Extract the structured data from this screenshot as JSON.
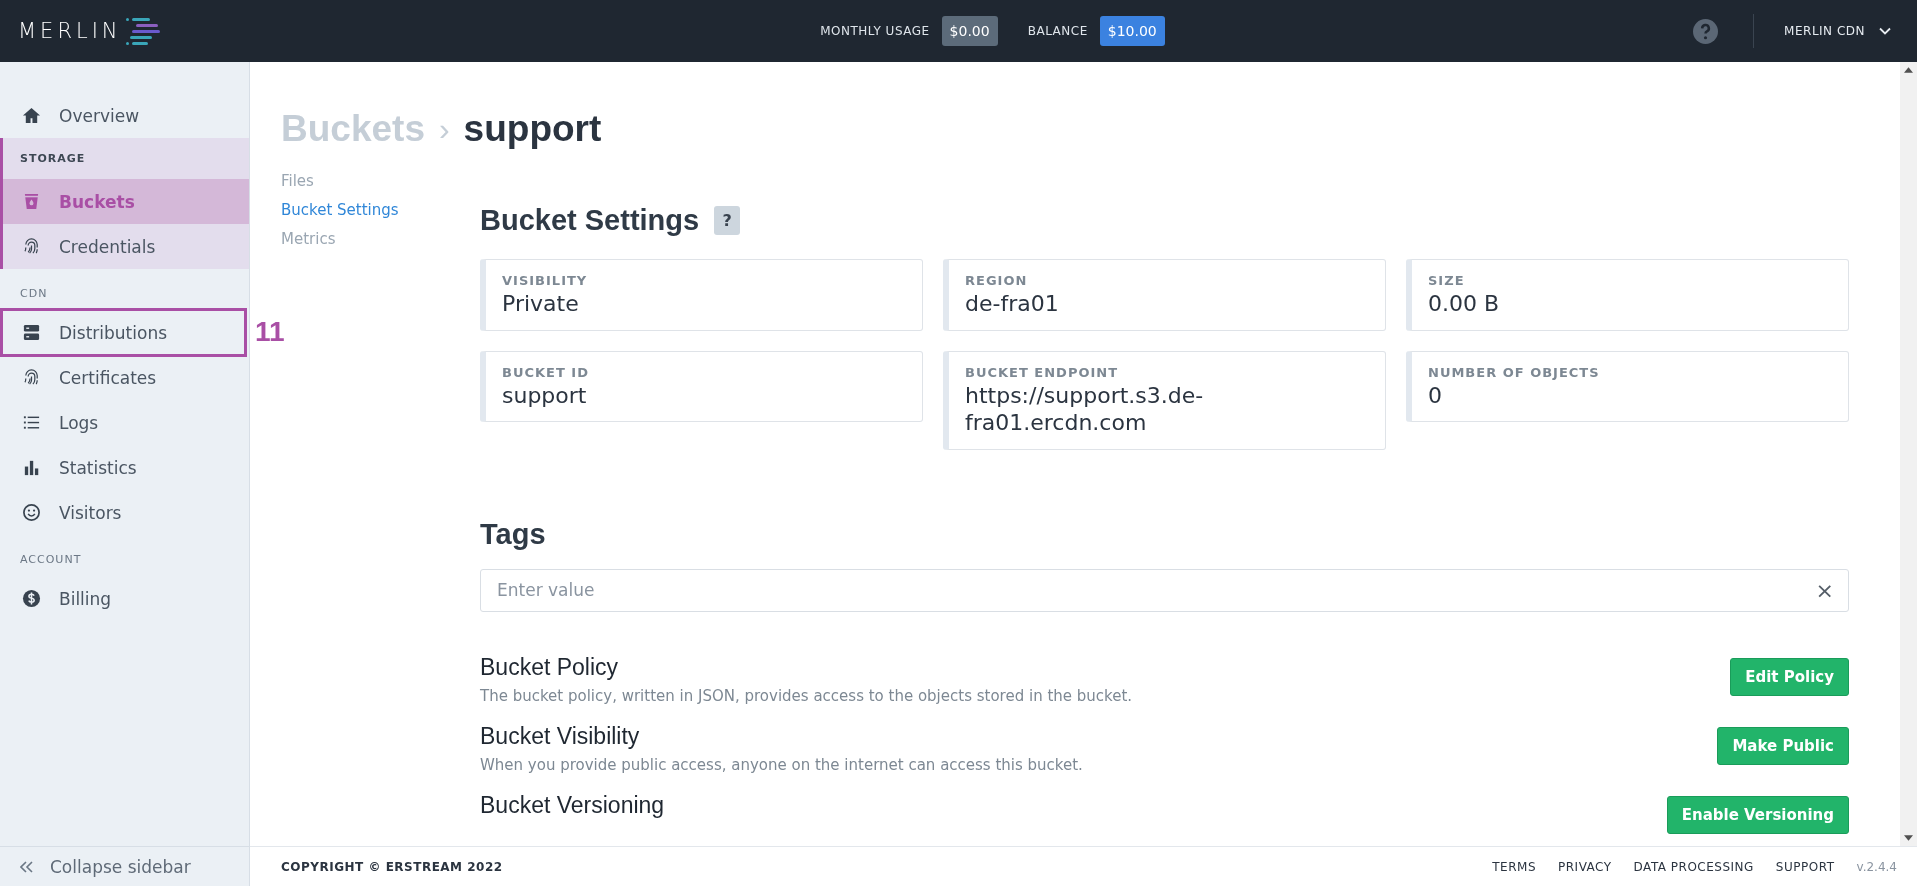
{
  "topbar": {
    "logo": "MERLIN",
    "meters": [
      {
        "label": "MONTHLY USAGE",
        "value": "$0.00",
        "color": "#5c6b7a"
      },
      {
        "label": "BALANCE",
        "value": "$10.00",
        "color": "#3b82e0"
      }
    ],
    "account": "MERLIN CDN"
  },
  "sidebar": {
    "items": [
      {
        "kind": "link",
        "label": "Overview",
        "selected": false
      },
      {
        "kind": "section",
        "label": "STORAGE",
        "active": true,
        "children": [
          {
            "label": "Buckets",
            "selected": true
          },
          {
            "label": "Credentials",
            "selected": false
          }
        ]
      },
      {
        "kind": "section",
        "label": "CDN",
        "active": false,
        "children": [
          {
            "label": "Distributions",
            "selected": false,
            "annotation": "11"
          },
          {
            "label": "Certificates",
            "selected": false
          },
          {
            "label": "Logs",
            "selected": false
          },
          {
            "label": "Statistics",
            "selected": false
          },
          {
            "label": "Visitors",
            "selected": false
          }
        ]
      },
      {
        "kind": "section",
        "label": "ACCOUNT",
        "active": false,
        "children": [
          {
            "label": "Billing",
            "selected": false
          }
        ]
      }
    ],
    "collapse": "Collapse sidebar"
  },
  "breadcrumb": {
    "parent": "Buckets",
    "separator": "›",
    "current": "support"
  },
  "subnav": [
    {
      "label": "Files",
      "selected": false
    },
    {
      "label": "Bucket Settings",
      "selected": true
    },
    {
      "label": "Metrics",
      "selected": false
    }
  ],
  "settings": {
    "title": "Bucket Settings",
    "help": "?",
    "fields": [
      {
        "label": "VISIBILITY",
        "value": "Private"
      },
      {
        "label": "REGION",
        "value": "de-fra01"
      },
      {
        "label": "SIZE",
        "value": "0.00 B"
      },
      {
        "label": "BUCKET ID",
        "value": "support"
      },
      {
        "label": "BUCKET ENDPOINT",
        "value": "https://support.s3.de-fra01.ercdn.com"
      },
      {
        "label": "NUMBER OF OBJECTS",
        "value": "0"
      }
    ]
  },
  "tags": {
    "title": "Tags",
    "placeholder": "Enter value",
    "clear": "×"
  },
  "actions": [
    {
      "title": "Bucket Policy",
      "description": "The bucket policy, written in JSON, provides access to the objects stored in the bucket.",
      "button": "Edit Policy"
    },
    {
      "title": "Bucket Visibility",
      "description": "When you provide public access, anyone on the internet can access this bucket.",
      "button": "Make Public"
    },
    {
      "title": "Bucket Versioning",
      "button": "Enable Versioning"
    }
  ],
  "footer": {
    "copyright": "COPYRIGHT © ERSTREAM 2022",
    "links": [
      "TERMS",
      "PRIVACY",
      "DATA PROCESSING",
      "SUPPORT"
    ],
    "version": "v.2.4.4"
  }
}
